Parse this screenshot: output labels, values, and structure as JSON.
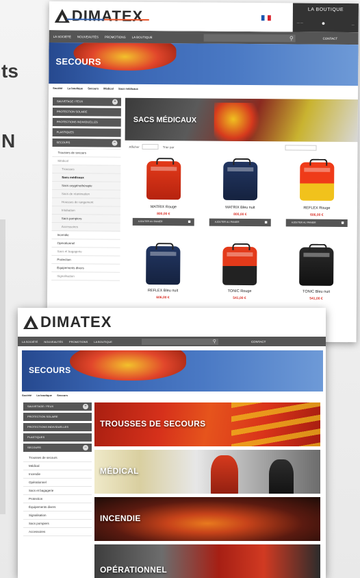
{
  "background": {
    "partial_text_1": "ts",
    "partial_text_2": "N"
  },
  "header": {
    "logo": "DIMATEX",
    "shop_title": "LA BOUTIQUE"
  },
  "nav": {
    "items": [
      "LA SOCIÉTÉ",
      "NOUVEAUTÉS",
      "PROMOTIONS",
      "LA BOUTIQUE"
    ],
    "contact": "CONTACT"
  },
  "page1": {
    "banner_title": "SECOURS",
    "breadcrumb": [
      "Société",
      "La boutique",
      "Secours",
      "Médical",
      "Sacs médicaux"
    ],
    "category_title": "SACS MÉDICAUX",
    "sidebar": [
      "SAUVETAGE / FEUX",
      "PROTECTION SOLAIRE",
      "PROTECTIONS INDIVIDUELLES",
      "PLASTIQUES",
      "SECOURS"
    ],
    "subitems": [
      {
        "label": "Trousses de secours",
        "style": ""
      },
      {
        "label": "Médical",
        "style": "dim"
      },
      {
        "label": "Trousses",
        "style": "deep dim"
      },
      {
        "label": "Sacs médicaux",
        "style": "deep active"
      },
      {
        "label": "Sacs oxygénothérapie",
        "style": "deep"
      },
      {
        "label": "Sacs de réanimation",
        "style": "deep dim"
      },
      {
        "label": "Housses de rangement",
        "style": "deep dim"
      },
      {
        "label": "Intubation",
        "style": "deep dim"
      },
      {
        "label": "Sacs pompiers",
        "style": "deep"
      },
      {
        "label": "Accessoires",
        "style": "deep dim"
      },
      {
        "label": "Incendie",
        "style": ""
      },
      {
        "label": "Opérationnel",
        "style": ""
      },
      {
        "label": "Sacs et bagagerie",
        "style": "dim"
      },
      {
        "label": "Protection",
        "style": ""
      },
      {
        "label": "Équipements divers",
        "style": ""
      },
      {
        "label": "Signalisation",
        "style": "dim"
      }
    ],
    "toolbar": {
      "show_label": "Afficher",
      "sort_label": "Trier par"
    },
    "add_to_cart": "AJOUTER AU PANIER",
    "products": [
      {
        "name": "MATRIX Rouge",
        "price": "800,00 €",
        "color": "red"
      },
      {
        "name": "MATRIX Bleu nuit",
        "price": "800,00 €",
        "color": "navy"
      },
      {
        "name": "REFLEX Rouge",
        "price": "606,00 €",
        "color": "redyellow"
      },
      {
        "name": "REFLEX Bleu nuit",
        "price": "606,00 €",
        "color": "navy"
      },
      {
        "name": "TONIC Rouge",
        "price": "541,00 €",
        "color": "redblack"
      },
      {
        "name": "TONIC Bleu nuit",
        "price": "541,00 €",
        "color": "black"
      }
    ]
  },
  "page2": {
    "banner_title": "SECOURS",
    "breadcrumb": [
      "Société",
      "La boutique",
      "Secours"
    ],
    "sidebar": [
      "SAUVETAGE / FEUX",
      "PROTECTION SOLAIRE",
      "PROTECTIONS INDIVIDUELLES",
      "PLASTIQUES",
      "SECOURS"
    ],
    "subitems": [
      {
        "label": "Trousses de secours",
        "style": ""
      },
      {
        "label": "Médical",
        "style": ""
      },
      {
        "label": "Incendie",
        "style": ""
      },
      {
        "label": "Opérationnel",
        "style": ""
      },
      {
        "label": "Sacs et bagagerie",
        "style": ""
      },
      {
        "label": "Protection",
        "style": ""
      },
      {
        "label": "Équipements divers",
        "style": ""
      },
      {
        "label": "Signalisation",
        "style": ""
      },
      {
        "label": "Sacs pompiers",
        "style": ""
      },
      {
        "label": "Accessoires",
        "style": ""
      }
    ],
    "tiles": [
      "TROUSSES DE SECOURS",
      "MÉDICAL",
      "INCENDIE",
      "OPÉRATIONNEL"
    ]
  },
  "colors": {
    "nav_bg": "#555555",
    "price_red": "#d9342b",
    "banner_blue": "#3a66b4"
  }
}
